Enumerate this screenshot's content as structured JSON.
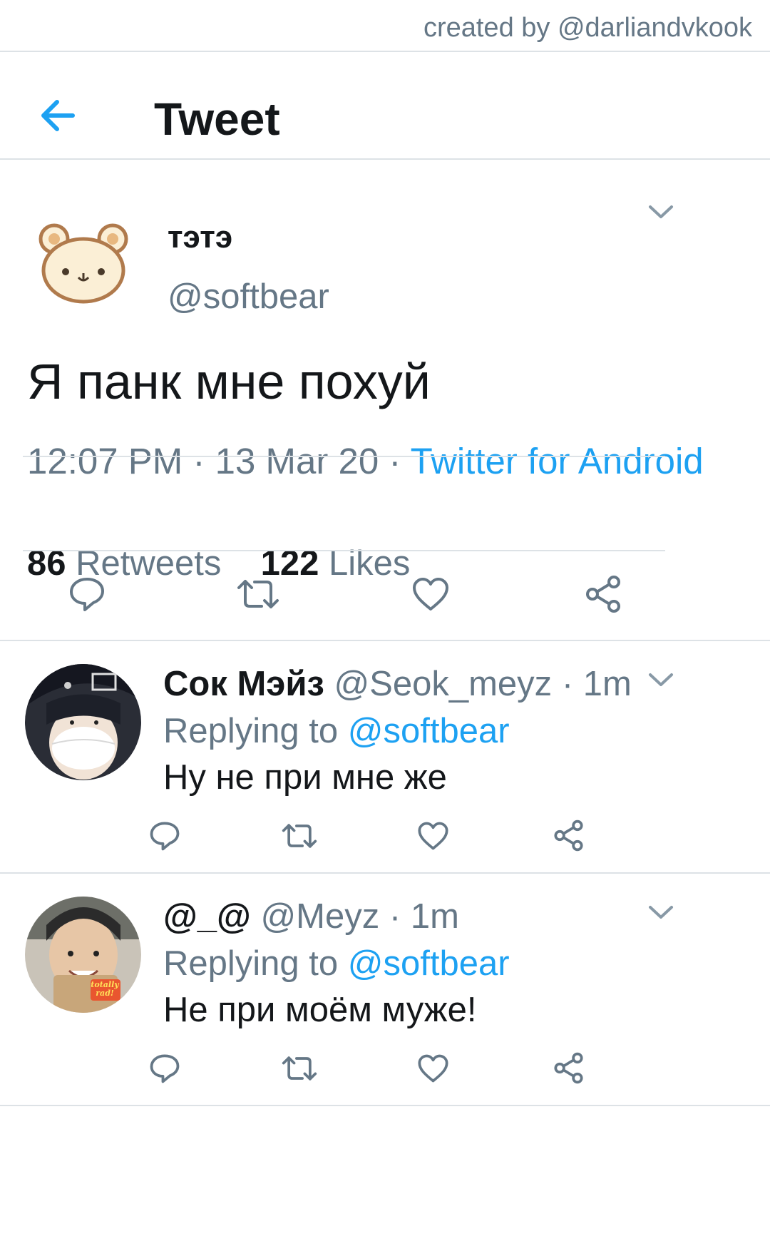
{
  "watermark": "created by @darliandvkook",
  "header": {
    "title": "Tweet",
    "back_icon": "arrow-left-icon"
  },
  "colors": {
    "accent": "#1da1f2",
    "secondary_text": "#657786",
    "primary_text": "#14171a",
    "divider": "#dde2e6"
  },
  "tweet": {
    "name": "тэтэ",
    "handle": "@softbear",
    "text": "Я панк мне похуй",
    "time": "12:07 PM",
    "date": "13 Mar 20",
    "source": "Twitter for Android",
    "retweets_count": "86",
    "retweets_label": "Retweets",
    "likes_count": "122",
    "likes_label": "Likes",
    "avatar_icon": "bear-face-icon"
  },
  "separator": "·",
  "replies": [
    {
      "name": "Сок Мэйз",
      "handle": "@Seok_meyz",
      "time": "1m",
      "replying_label": "Replying to",
      "replying_handle": "@softbear",
      "text": "Ну не при мне же"
    },
    {
      "name": "@_@",
      "handle": "@Meyz",
      "time": "1m",
      "replying_label": "Replying to",
      "replying_handle": "@softbear",
      "text": "Не при моём муже!",
      "avatar_sticker": "totally rad!"
    }
  ],
  "action_icons": [
    "reply-icon",
    "retweet-icon",
    "like-icon",
    "share-icon"
  ]
}
